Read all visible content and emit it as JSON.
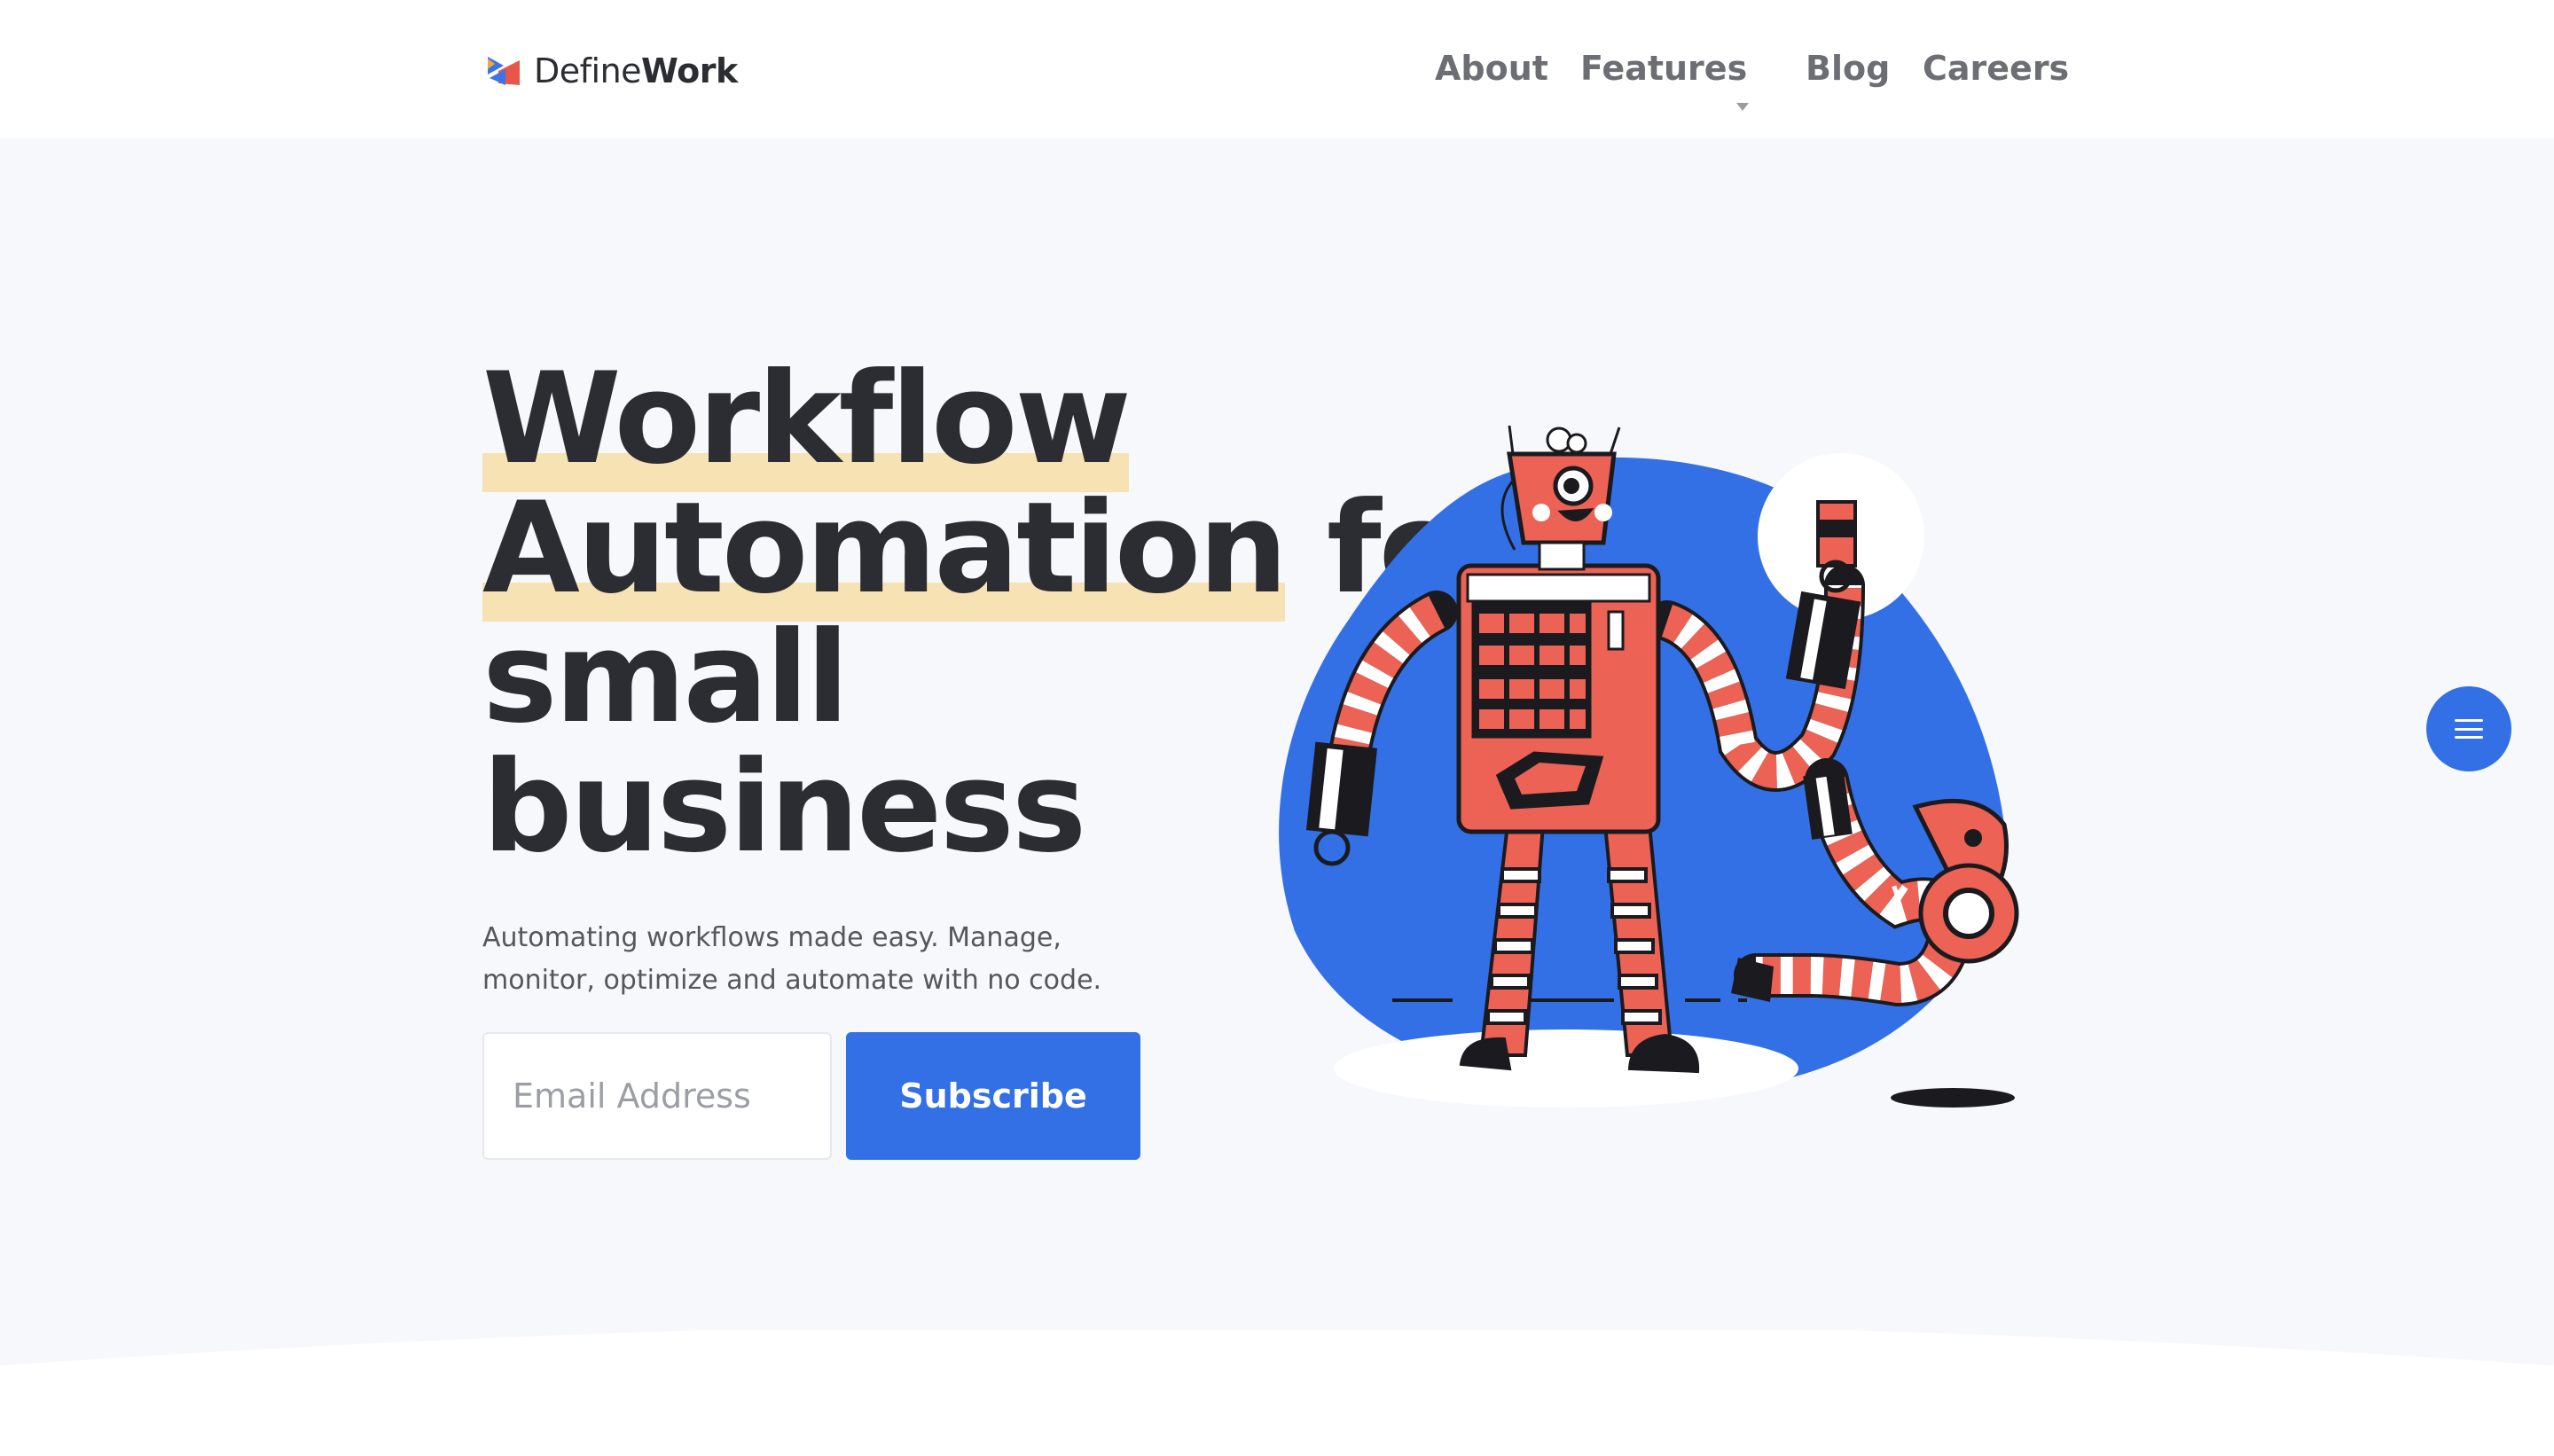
{
  "brand": {
    "name_light": "Define",
    "name_bold": "Work"
  },
  "nav": {
    "items": [
      {
        "label": "About"
      },
      {
        "label": "Features"
      },
      {
        "label": "Blog"
      },
      {
        "label": "Careers"
      }
    ]
  },
  "hero": {
    "title_lines": {
      "highlight_1": "Workflow",
      "highlight_2": "Automation",
      "after_highlight_2": " for",
      "line_3": "small",
      "line_4": "business"
    },
    "subtitle": "Automating workflows made easy. Manage, monitor, optimize and automate with no code.",
    "email_placeholder": "Email Address",
    "subscribe_label": "Subscribe"
  },
  "colors": {
    "accent": "#3370e6",
    "highlight": "#f6e2b3",
    "robot": "#ec6254",
    "text": "#2b2d33"
  },
  "icons": {
    "menu": "hamburger-menu-icon",
    "dropdown": "caret-down-icon"
  }
}
